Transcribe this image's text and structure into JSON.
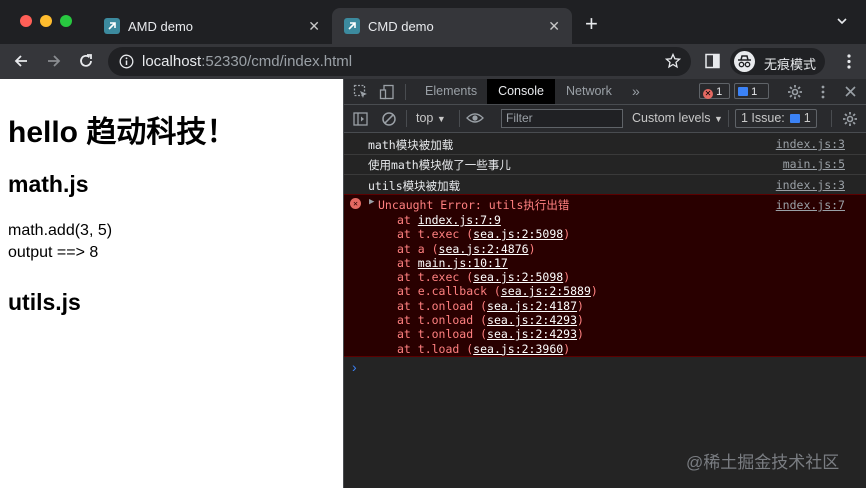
{
  "browser": {
    "tabs": [
      {
        "title": "AMD demo",
        "active": false
      },
      {
        "title": "CMD demo",
        "active": true
      }
    ],
    "new_tab": "+",
    "address": {
      "host": "localhost",
      "path": ":52330/cmd/index.html"
    },
    "incognito_label": "无痕模式"
  },
  "page": {
    "heading": "hello 趋动科技！",
    "sections": [
      {
        "title": "math.js",
        "lines": [
          "math.add(3, 5)",
          "output ==> 8"
        ]
      },
      {
        "title": "utils.js"
      }
    ]
  },
  "devtools": {
    "tabs": [
      "Elements",
      "Console",
      "Network"
    ],
    "active_tab": "Console",
    "more_tabs": "»",
    "error_count": "1",
    "message_count": "1",
    "context": "top",
    "filter_placeholder": "Filter",
    "levels": "Custom levels",
    "issues": "1 Issue:",
    "issues_count": "1",
    "messages": [
      {
        "text": "math模块被加载",
        "source": "index.js:3"
      },
      {
        "text": "使用math模块做了一些事儿",
        "source": "main.js:5"
      },
      {
        "text": "utils模块被加载",
        "source": "index.js:3"
      }
    ],
    "error": {
      "text": "Uncaught Error: utils执行出错",
      "source": "index.js:7",
      "stack": [
        {
          "fn": "",
          "loc": "index.js:7:9"
        },
        {
          "fn": "t.exec",
          "loc": "sea.js:2:5098"
        },
        {
          "fn": "a",
          "loc": "sea.js:2:4876"
        },
        {
          "fn": "",
          "loc": "main.js:10:17"
        },
        {
          "fn": "t.exec",
          "loc": "sea.js:2:5098"
        },
        {
          "fn": "e.callback",
          "loc": "sea.js:2:5889"
        },
        {
          "fn": "t.onload",
          "loc": "sea.js:2:4187"
        },
        {
          "fn": "t.onload",
          "loc": "sea.js:2:4293"
        },
        {
          "fn": "t.onload",
          "loc": "sea.js:2:4293"
        },
        {
          "fn": "t.load",
          "loc": "sea.js:2:3960"
        }
      ]
    },
    "prompt": "›"
  },
  "watermark": "@稀土掘金技术社区",
  "colors": {
    "error_bg": "#290000",
    "error_text": "#ff8080",
    "page_bg": "#ffffff",
    "chrome_bg": "#202124"
  }
}
